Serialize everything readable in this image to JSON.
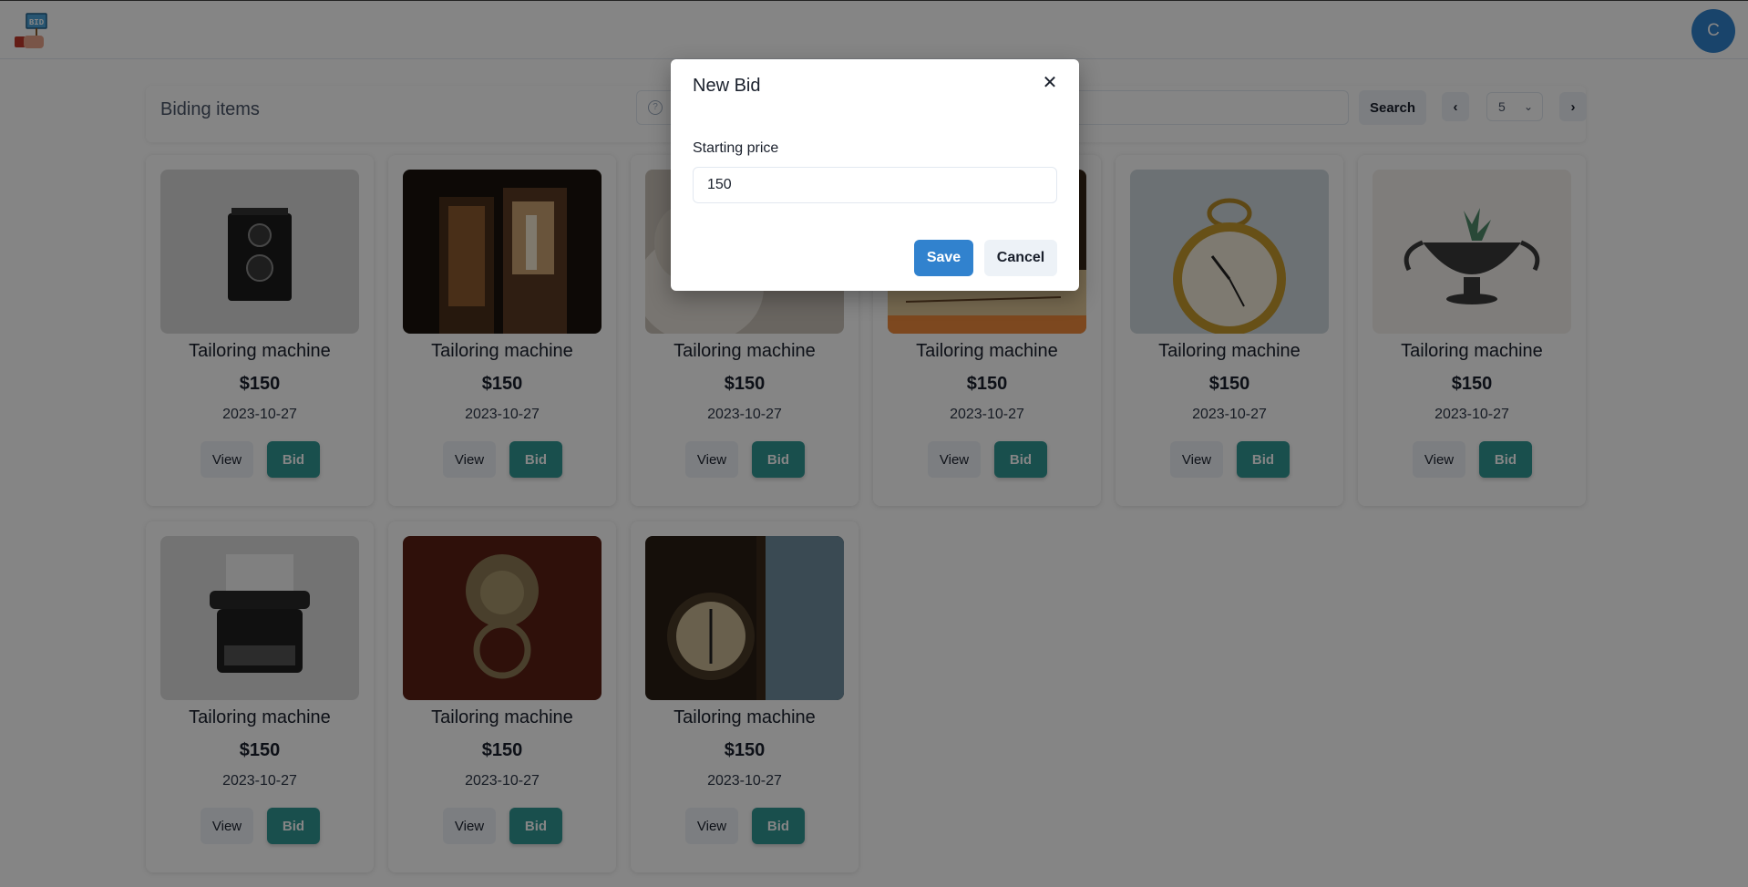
{
  "header": {
    "logo_text": "BID",
    "avatar_initial": "C"
  },
  "toolbar": {
    "title": "Biding items",
    "search_placeholder": "",
    "search_label": "Search",
    "prev_label": "‹",
    "next_label": "›",
    "page_size": "5"
  },
  "items": [
    {
      "name": "Tailoring machine",
      "price": "$150",
      "date": "2023-10-27",
      "view_label": "View",
      "bid_label": "Bid",
      "image": "camera"
    },
    {
      "name": "Tailoring machine",
      "price": "$150",
      "date": "2023-10-27",
      "view_label": "View",
      "bid_label": "Bid",
      "image": "doorway"
    },
    {
      "name": "Tailoring machine",
      "price": "$150",
      "date": "2023-10-27",
      "view_label": "View",
      "bid_label": "Bid",
      "image": "statue"
    },
    {
      "name": "Tailoring machine",
      "price": "$150",
      "date": "2023-10-27",
      "view_label": "View",
      "bid_label": "Bid",
      "image": "old-book"
    },
    {
      "name": "Tailoring machine",
      "price": "$150",
      "date": "2023-10-27",
      "view_label": "View",
      "bid_label": "Bid",
      "image": "pocket-clock"
    },
    {
      "name": "Tailoring machine",
      "price": "$150",
      "date": "2023-10-27",
      "view_label": "View",
      "bid_label": "Bid",
      "image": "succulent-cup"
    },
    {
      "name": "Tailoring machine",
      "price": "$150",
      "date": "2023-10-27",
      "view_label": "View",
      "bid_label": "Bid",
      "image": "typewriter"
    },
    {
      "name": "Tailoring machine",
      "price": "$150",
      "date": "2023-10-27",
      "view_label": "View",
      "bid_label": "Bid",
      "image": "lion-door-knocker"
    },
    {
      "name": "Tailoring machine",
      "price": "$150",
      "date": "2023-10-27",
      "view_label": "View",
      "bid_label": "Bid",
      "image": "compass"
    }
  ],
  "modal": {
    "title": "New Bid",
    "close_label": "✕",
    "field_label": "Starting price",
    "field_value": "150",
    "save_label": "Save",
    "cancel_label": "Cancel"
  },
  "colors": {
    "primary": "#3182ce",
    "teal": "#319795",
    "gray_button": "#edf2f7",
    "overlay": "rgba(0,0,0,0.48)"
  }
}
